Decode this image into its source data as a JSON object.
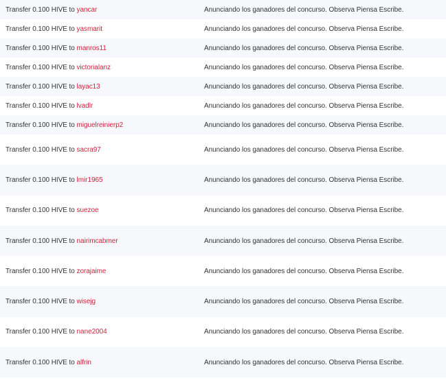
{
  "theme": {
    "link_color": "#d1213c",
    "row_alt_bg": "#f7f8fb",
    "text_color": "#333333"
  },
  "transfers": [
    {
      "op": "Transfer 0.100 HIVE to",
      "user": "yancar",
      "memo": "Anunciando los ganadores del concurso. Observa Piensa Escribe."
    },
    {
      "op": "Transfer 0.100 HIVE to",
      "user": "yasmarit",
      "memo": "Anunciando los ganadores del concurso. Observa Piensa Escribe."
    },
    {
      "op": "Transfer 0.100 HIVE to",
      "user": "manros11",
      "memo": "Anunciando los ganadores del concurso. Observa Piensa Escribe."
    },
    {
      "op": "Transfer 0.100 HIVE to",
      "user": "victorialanz",
      "memo": "Anunciando los ganadores del concurso. Observa Piensa Escribe."
    },
    {
      "op": "Transfer 0.100 HIVE to",
      "user": "layac13",
      "memo": "Anunciando los ganadores del concurso. Observa Piensa Escribe."
    },
    {
      "op": "Transfer 0.100 HIVE to",
      "user": "lvadlr",
      "memo": "Anunciando los ganadores del concurso. Observa Piensa Escribe."
    },
    {
      "op": "Transfer 0.100 HIVE to",
      "user": "miguelreinierp2",
      "memo": "Anunciando los ganadores del concurso. Observa Piensa Escribe."
    },
    {
      "op": "Transfer 0.100 HIVE to",
      "user": "sacra97",
      "memo": "Anunciando los ganadores del concurso. Observa Piensa Escribe."
    },
    {
      "op": "Transfer 0.100 HIVE to",
      "user": "lmir1965",
      "memo": "Anunciando los ganadores del concurso. Observa Piensa Escribe."
    },
    {
      "op": "Transfer 0.100 HIVE to",
      "user": "suezoe",
      "memo": "Anunciando los ganadores del concurso. Observa Piensa Escribe."
    },
    {
      "op": "Transfer 0.100 HIVE to",
      "user": "nairimcabmer",
      "memo": "Anunciando los ganadores del concurso. Observa Piensa Escribe."
    },
    {
      "op": "Transfer 0.100 HIVE to",
      "user": "zorajaime",
      "memo": "Anunciando los ganadores del concurso. Observa Piensa Escribe."
    },
    {
      "op": "Transfer 0.100 HIVE to",
      "user": "wisejg",
      "memo": "Anunciando los ganadores del concurso. Observa Piensa Escribe."
    },
    {
      "op": "Transfer 0.100 HIVE to",
      "user": "nane2004",
      "memo": "Anunciando los ganadores del concurso. Observa Piensa Escribe."
    },
    {
      "op": "Transfer 0.100 HIVE to",
      "user": "alfrin",
      "memo": "Anunciando los ganadores del concurso. Observa Piensa Escribe."
    }
  ]
}
